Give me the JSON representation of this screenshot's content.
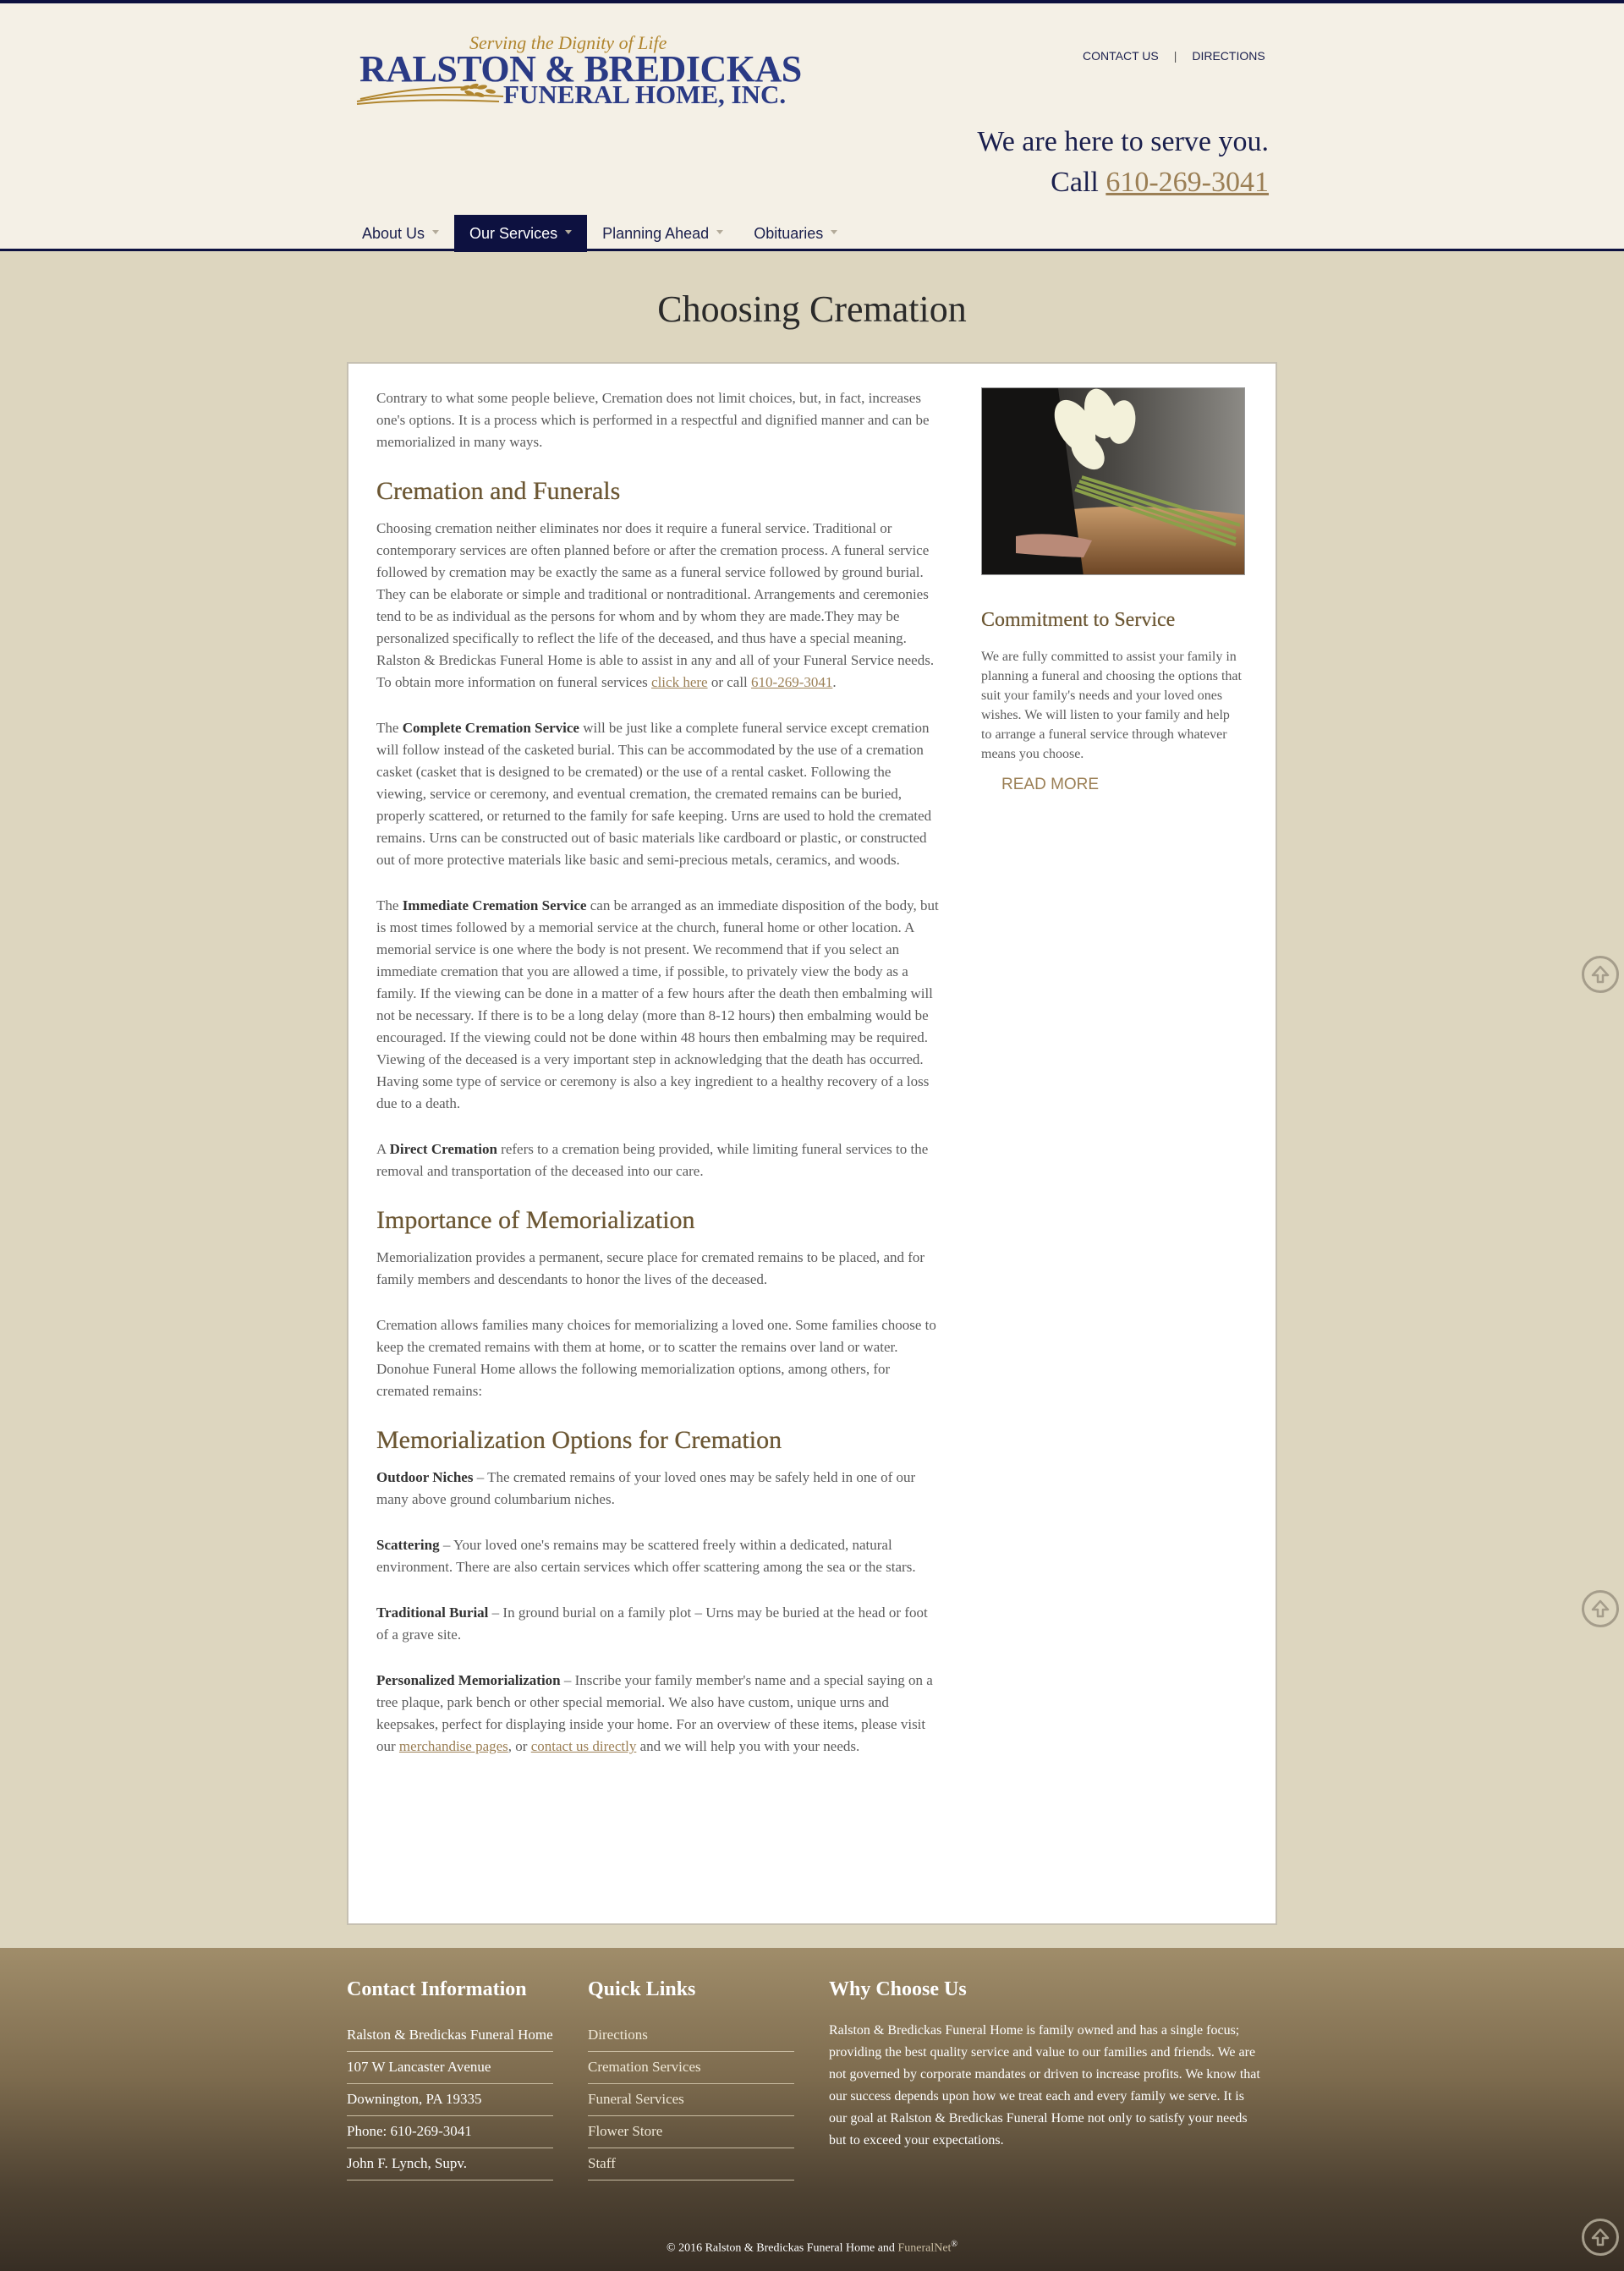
{
  "header": {
    "tagline": "Serving the Dignity of Life",
    "logo_line1": "RALSTON & BREDICKAS",
    "logo_line2": "FUNERAL HOME, INC.",
    "links": [
      "CONTACT US",
      "DIRECTIONS"
    ],
    "serve_text": "We are here to serve you.",
    "call_label": "Call",
    "phone": "610-269-3041"
  },
  "nav": {
    "items": [
      {
        "label": "About Us"
      },
      {
        "label": "Our Services",
        "active": true
      },
      {
        "label": "Planning Ahead"
      },
      {
        "label": "Obituaries"
      }
    ]
  },
  "page": {
    "title": "Choosing Cremation",
    "intro": "Contrary to what some people believe, Cremation does not limit choices, but, in fact, increases one's options. It is a process which is performed in a respectful and dignified manner and can be memorialized in many ways.",
    "h_funerals": "Cremation and Funerals",
    "p_funerals": "Choosing cremation neither eliminates nor does it require a funeral service. Traditional or contemporary services are often planned before or after the cremation process. A funeral service followed by cremation may be exactly the same as a funeral service followed by ground burial. They can be elaborate or simple and traditional or nontraditional. Arrangements and ceremonies tend to be as individual as the persons for whom and by whom they are made.They may be personalized specifically to reflect the life of the deceased, and thus have a special meaning. Ralston & Bredickas Funeral Home is able to assist in any and all of your Funeral Service needs. To obtain more information on funeral services",
    "click_here": "click here",
    "or_call": "or call",
    "phone": "610-269-3041",
    "complete_pre": "The",
    "complete_bold": "Complete Cremation Service",
    "complete_rest": "will be just like a complete funeral service except cremation will follow instead of the casketed burial. This can be accommodated by the use of a cremation casket (casket that is designed to be cremated) or the use of a rental casket. Following the viewing, service or ceremony, and eventual cremation, the cremated remains can be buried, properly scattered, or returned to the family for safe keeping. Urns are used to hold the cremated remains. Urns can be constructed out of basic materials like cardboard or plastic, or constructed out of more protective materials like basic and semi-precious metals, ceramics, and woods.",
    "immediate_pre": "The",
    "immediate_bold": "Immediate Cremation Service",
    "immediate_rest": "can be arranged as an immediate disposition of the body, but is most times followed by a memorial service at the church, funeral home or other location. A memorial service is one where the body is not present. We recommend that if you select an immediate cremation that you are allowed a time, if possible, to privately view the body as a family. If the viewing can be done in a matter of a few hours after the death then embalming will not be necessary. If there is to be a long delay (more than 8-12 hours) then embalming would be encouraged. If the viewing could not be done within 48 hours then embalming may be required. Viewing of the deceased is a very important step in acknowledging that the death has occurred. Having some type of service or ceremony is also a key ingredient to a healthy recovery of a loss due to a death.",
    "direct_pre": "A",
    "direct_bold": "Direct Cremation",
    "direct_rest": "refers to a cremation being provided, while limiting funeral services to the removal and transportation of the deceased into our care.",
    "h_importance": "Importance of Memorialization",
    "p_importance1": "Memorialization provides a permanent, secure place for cremated remains to be placed, and for family members and descendants to honor the lives of the deceased.",
    "p_importance2": "Cremation allows families many choices for memorializing a loved one. Some families choose to keep the cremated remains with them at home, or to scatter the remains over land or water. Donohue Funeral Home allows the following memorialization options, among others, for cremated remains:",
    "h_options": "Memorialization Options for Cremation",
    "niches_bold": "Outdoor Niches",
    "niches_rest": "– The cremated remains of your loved ones may be safely held in one of our many above ground columbarium niches.",
    "scatter_bold": "Scattering",
    "scatter_rest": "– Your loved one's remains may be scattered freely within a dedicated, natural environment. There are also certain services which offer scattering among the sea or the stars.",
    "burial_bold": "Traditional Burial",
    "burial_rest": "– In ground burial on a family plot – Urns may be buried at the head or foot of a grave site.",
    "personal_bold": "Personalized Memorialization",
    "personal_rest": "– Inscribe your family member's name and a special saying on a tree plaque, park bench or other special memorial. We also have custom, unique urns and keepsakes, perfect for displaying inside your home. For an overview of these items, please visit our",
    "merch_link": "merchandise pages",
    "or_text": ", or",
    "contact_link": "contact us directly",
    "personal_end": "and we will help you with your needs."
  },
  "sidebar": {
    "title": "Commitment to Service",
    "text": "We are fully committed to assist your family in planning a funeral and choosing the options that suit your family's needs and your loved ones wishes. We will listen to your family and help to arrange a funeral service through whatever means you choose.",
    "read_more": "READ MORE"
  },
  "footer": {
    "contact_title": "Contact Information",
    "contact_rows": [
      "Ralston & Bredickas Funeral Home",
      "107 W Lancaster Avenue",
      "Downington, PA 19335",
      "Phone: 610-269-3041",
      "John F. Lynch, Supv."
    ],
    "links_title": "Quick Links",
    "links": [
      "Directions",
      "Cremation Services",
      "Funeral Services",
      "Flower Store",
      "Staff"
    ],
    "why_title": "Why Choose Us",
    "why_text": "Ralston & Bredickas Funeral Home is family owned and has a single focus; providing the best quality service and value to our families and friends. We are not governed by corporate mandates or driven to increase profits. We know that our success depends upon how we treat each and every family we serve. It is our goal at Ralston & Bredickas Funeral Home not only to satisfy your needs but to exceed your expectations.",
    "copyright": "© 2016 Ralston & Bredickas Funeral Home and",
    "funeralnet": "FuneralNet",
    "reg": "®"
  },
  "colors": {
    "navy": "#0d1140",
    "gold": "#9b7f55",
    "heading_brown": "#6b5632"
  }
}
